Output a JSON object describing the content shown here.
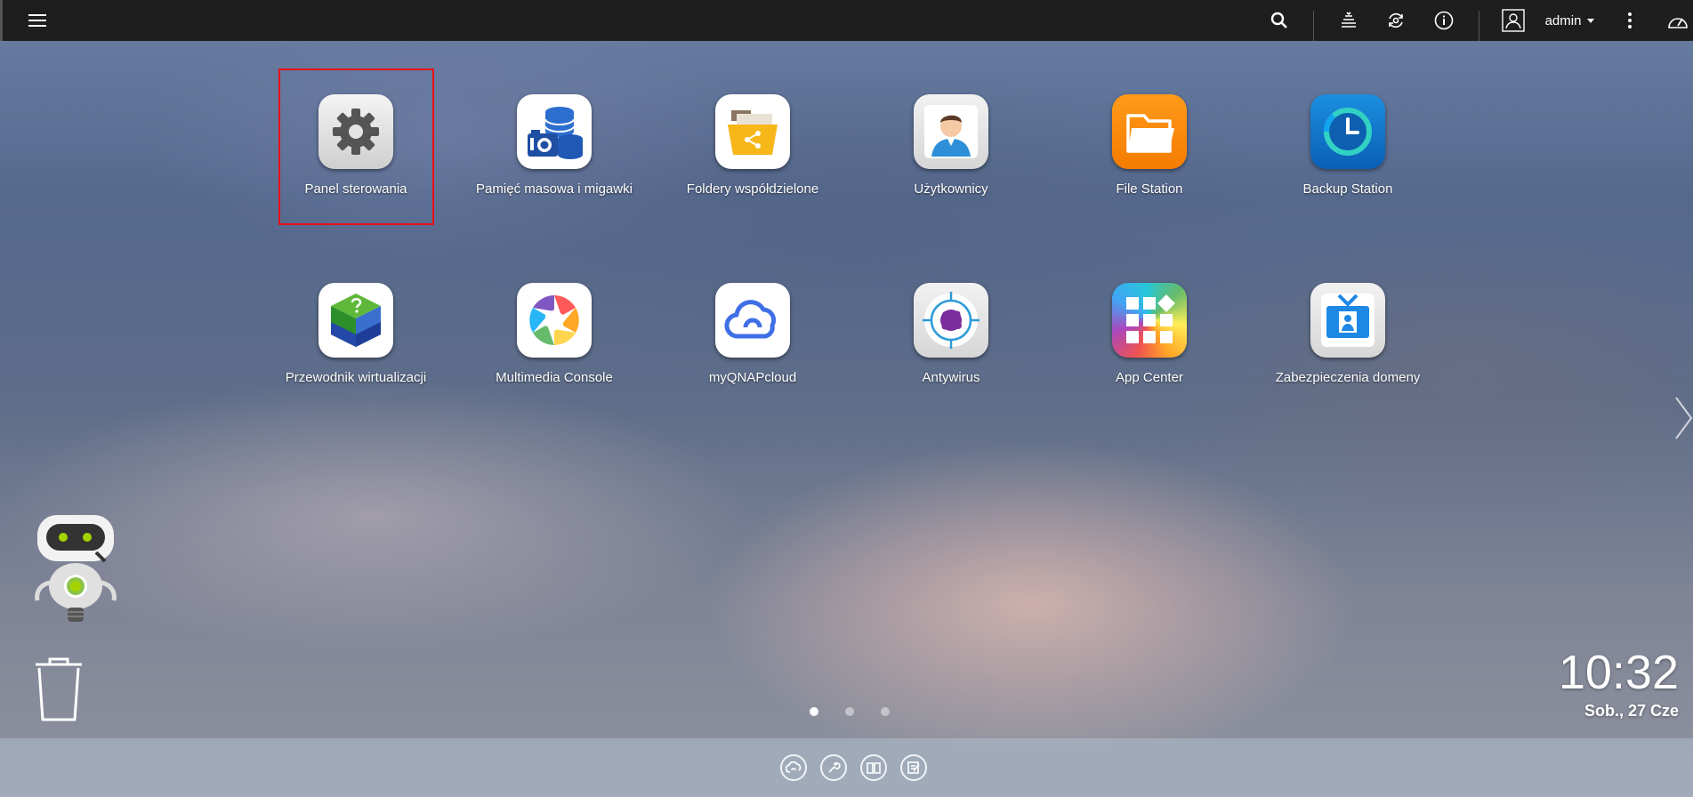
{
  "topbar": {
    "menu_icon": "hamburger-icon",
    "search_icon": "search-icon",
    "tasks_icon": "stack-icon",
    "sync_icon": "sync-icon",
    "info_icon": "info-icon",
    "user_icon": "user-icon",
    "username": "admin",
    "more_icon": "more-vertical-icon",
    "dashboard_icon": "gauge-icon"
  },
  "apps": [
    {
      "label": "Panel sterowania",
      "icon": "gear-icon"
    },
    {
      "label": "Pamięć masowa i migawki",
      "icon": "storage-icon"
    },
    {
      "label": "Foldery współdzielone",
      "icon": "shared-folder-icon"
    },
    {
      "label": "Użytkownicy",
      "icon": "user-icon"
    },
    {
      "label": "File Station",
      "icon": "folder-icon"
    },
    {
      "label": "Backup Station",
      "icon": "clock-icon"
    },
    {
      "label": "Przewodnik wirtualizacji",
      "icon": "cube-icon"
    },
    {
      "label": "Multimedia Console",
      "icon": "aperture-icon"
    },
    {
      "label": "myQNAPcloud",
      "icon": "cloud-icon"
    },
    {
      "label": "Antywirus",
      "icon": "virus-icon"
    },
    {
      "label": "App Center",
      "icon": "grid-icon"
    },
    {
      "label": "Zabezpieczenia domeny",
      "icon": "id-badge-icon"
    }
  ],
  "pager": {
    "pages": 3,
    "active": 1
  },
  "clock": {
    "time": "10:32",
    "date": "Sob., 27 Cze"
  },
  "dock": [
    "cloud-icon",
    "wrench-icon",
    "book-icon",
    "notes-icon"
  ],
  "colors": {
    "topbar": "#1e1e1e",
    "selection": "#e8101a"
  }
}
